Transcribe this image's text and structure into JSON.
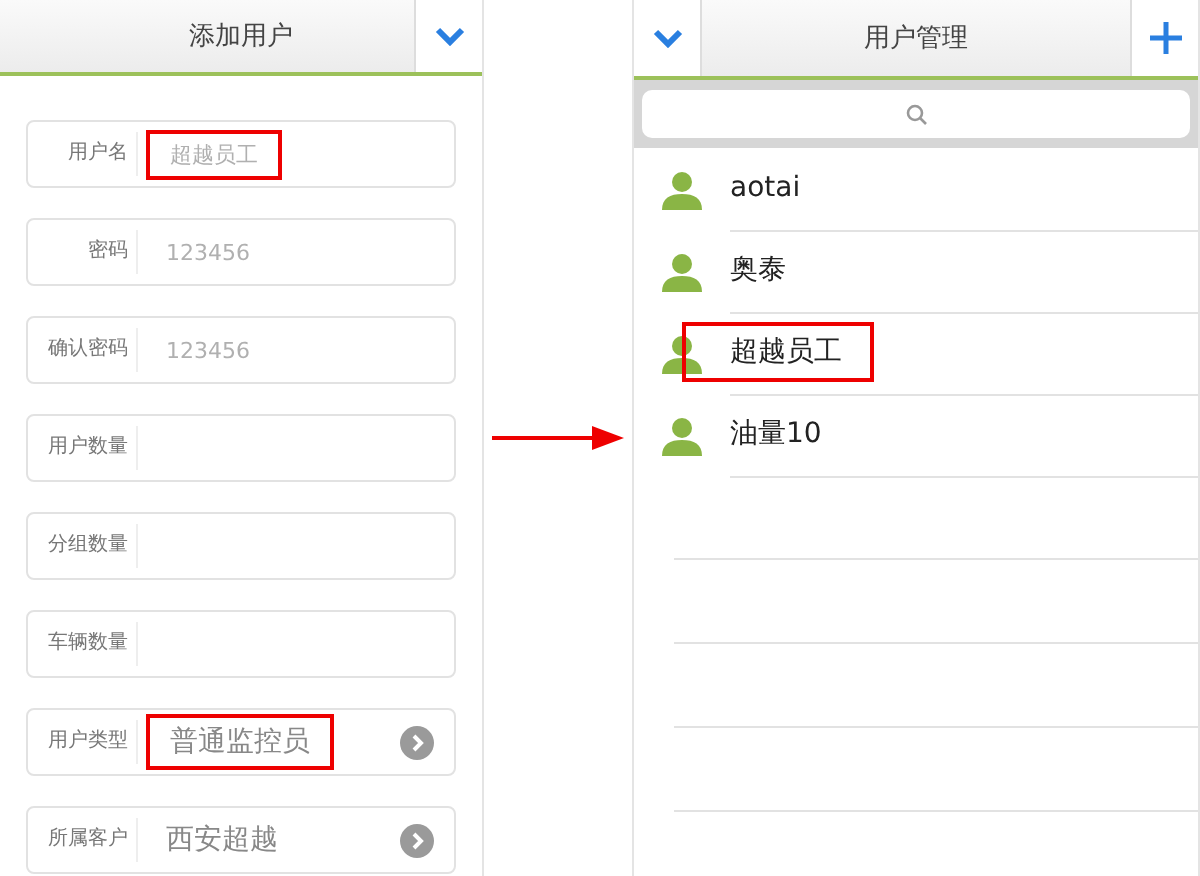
{
  "add_user_screen": {
    "title": "添加用户",
    "fields": [
      {
        "label": "用户名",
        "value": "超越员工",
        "kind": "text",
        "muted": true,
        "highlighted": true
      },
      {
        "label": "密码",
        "value": "123456",
        "kind": "text",
        "muted": true,
        "highlighted": false
      },
      {
        "label": "确认密码",
        "value": "123456",
        "kind": "text",
        "muted": true,
        "highlighted": false
      },
      {
        "label": "用户数量",
        "kind": "text"
      },
      {
        "label": "分组数量",
        "kind": "text"
      },
      {
        "label": "车辆数量",
        "kind": "text"
      },
      {
        "label": "用户类型",
        "value": "普通监控员",
        "kind": "select",
        "muted": false,
        "highlighted": true
      },
      {
        "label": "所属客户",
        "value": "西安超越",
        "kind": "select",
        "muted": false,
        "highlighted": false
      }
    ]
  },
  "user_management_screen": {
    "title": "用户管理",
    "users": [
      {
        "name": "aotai",
        "highlighted": false
      },
      {
        "name": "奥泰",
        "highlighted": false
      },
      {
        "name": "超越员工",
        "highlighted": true
      },
      {
        "name": "油量10",
        "highlighted": false
      }
    ]
  }
}
